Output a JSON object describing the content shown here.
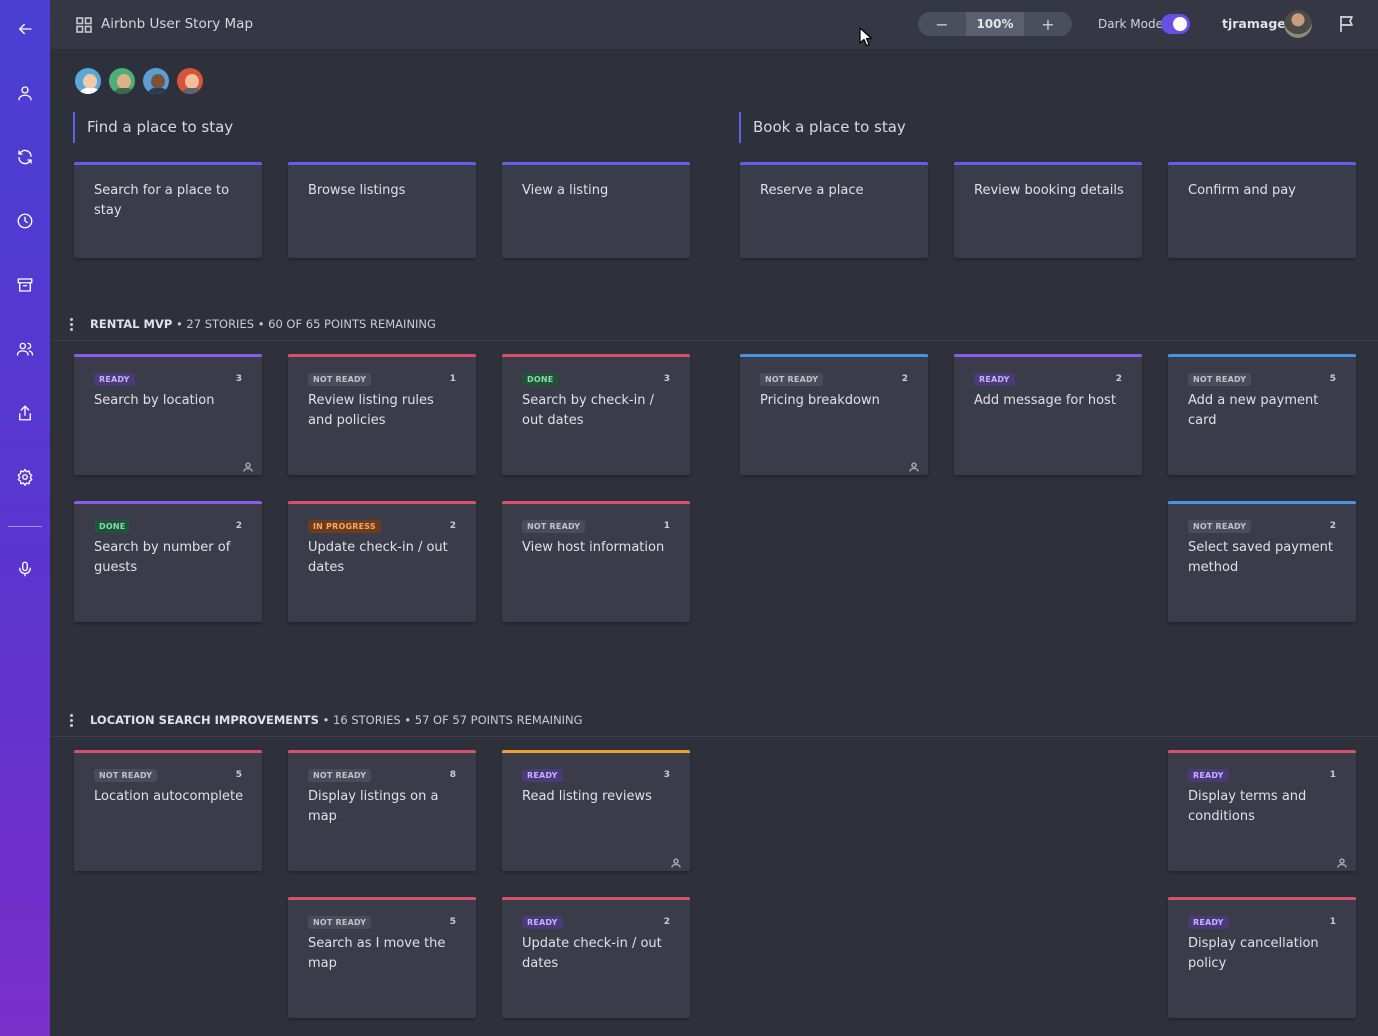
{
  "header": {
    "title": "Airbnb User Story Map",
    "zoom": "100%",
    "zoom_out": "−",
    "zoom_in": "+",
    "dark_mode_label": "Dark Mode",
    "username": "tjramage"
  },
  "activities": [
    {
      "title": "Find a place to stay"
    },
    {
      "title": "Book a place to stay"
    }
  ],
  "epics": [
    {
      "text": "Search for a place to stay"
    },
    {
      "text": "Browse listings"
    },
    {
      "text": "View a listing"
    },
    {
      "text": "Reserve a place"
    },
    {
      "text": "Review booking details"
    },
    {
      "text": "Confirm and pay"
    }
  ],
  "releases": [
    {
      "name": "RENTAL MVP",
      "stories": "27 STORIES",
      "points": "60 OF 65 POINTS REMAINING",
      "cards": [
        {
          "status": "READY",
          "points": "3",
          "text": "Search by location"
        },
        {
          "status": "NOT READY",
          "points": "1",
          "text": "Review listing rules and policies"
        },
        {
          "status": "DONE",
          "points": "3",
          "text": "Search by check-in / out dates"
        },
        {
          "status": "NOT READY",
          "points": "2",
          "text": "Pricing breakdown"
        },
        {
          "status": "READY",
          "points": "2",
          "text": "Add message for host"
        },
        {
          "status": "NOT READY",
          "points": "5",
          "text": "Add a new payment card"
        },
        {
          "status": "DONE",
          "points": "2",
          "text": "Search by number of guests"
        },
        {
          "status": "IN PROGRESS",
          "points": "2",
          "text": "Update check-in / out dates"
        },
        {
          "status": "NOT READY",
          "points": "1",
          "text": "View host information"
        },
        {
          "status": "NOT READY",
          "points": "2",
          "text": "Select saved payment method"
        }
      ]
    },
    {
      "name": "LOCATION SEARCH IMPROVEMENTS",
      "stories": "16 STORIES",
      "points": "57 OF 57 POINTS REMAINING",
      "cards": [
        {
          "status": "NOT READY",
          "points": "5",
          "text": "Location autocomplete"
        },
        {
          "status": "NOT READY",
          "points": "8",
          "text": "Display listings on a map"
        },
        {
          "status": "READY",
          "points": "3",
          "text": "Read listing reviews"
        },
        {
          "status": "READY",
          "points": "1",
          "text": "Display terms and conditions"
        },
        {
          "status": "NOT READY",
          "points": "5",
          "text": "Search as I move the map"
        },
        {
          "status": "READY",
          "points": "2",
          "text": "Update check-in / out dates"
        },
        {
          "status": "READY",
          "points": "1",
          "text": "Display cancellation policy"
        }
      ]
    }
  ],
  "colors": {
    "sidebar_top": "#4a3fd2",
    "sidebar_bottom": "#7a2fc9",
    "accent_purple": "#6a5be8",
    "border_red": "#d9506a",
    "border_blue": "#4a93e0",
    "border_orange": "#f0a030",
    "background": "#2e313b",
    "card": "#3a3d49"
  }
}
